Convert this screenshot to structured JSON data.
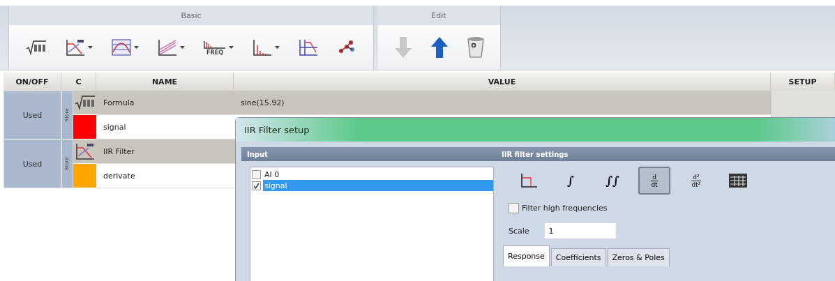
{
  "ribbon": {
    "groups": [
      {
        "label": "Basic",
        "buttons": [
          {
            "kind": "formula",
            "dropdown": false,
            "disabled": false
          },
          {
            "kind": "iir",
            "dropdown": true,
            "disabled": false
          },
          {
            "kind": "average",
            "dropdown": true,
            "disabled": false
          },
          {
            "kind": "regression",
            "dropdown": true,
            "disabled": false
          },
          {
            "kind": "freq",
            "text": "FREQ",
            "dropdown": true,
            "disabled": false
          },
          {
            "kind": "spectrum",
            "dropdown": true,
            "disabled": false
          },
          {
            "kind": "bode",
            "dropdown": false,
            "disabled": false
          },
          {
            "kind": "scatter",
            "dropdown": false,
            "disabled": false
          }
        ]
      },
      {
        "label": "Edit",
        "buttons": [
          {
            "kind": "down",
            "dropdown": false,
            "disabled": true
          },
          {
            "kind": "up",
            "dropdown": false,
            "disabled": false
          },
          {
            "kind": "delete",
            "dropdown": false,
            "disabled": false
          }
        ]
      }
    ]
  },
  "table": {
    "columns": [
      "ON/OFF",
      "C",
      "NAME",
      "VALUE",
      "SETUP"
    ],
    "groups": [
      {
        "status": "Used",
        "store": "Store",
        "rows": [
          {
            "kind": "formula",
            "name": "Formula",
            "value": "sine(15.92)"
          },
          {
            "kind": "channel",
            "color": "#ff0000",
            "name": "signal"
          }
        ]
      },
      {
        "status": "Used",
        "store": "Store",
        "rows": [
          {
            "kind": "iir",
            "name": "IIR Filter"
          },
          {
            "kind": "channel",
            "color": "#ffa500",
            "name": "derivate"
          }
        ]
      }
    ]
  },
  "dialog": {
    "title": "IIR Filter setup",
    "input": {
      "title": "Input",
      "items": [
        {
          "label": "AI 0",
          "checked": false,
          "selected": false
        },
        {
          "label": "signal",
          "checked": true,
          "selected": true
        }
      ]
    },
    "settings": {
      "title": "IIR filter settings",
      "modes": [
        {
          "kind": "lowpass",
          "selected": false
        },
        {
          "kind": "symbol",
          "text": "∫",
          "selected": false
        },
        {
          "kind": "symbol",
          "text": "∫∫",
          "selected": false
        },
        {
          "kind": "fraction",
          "numerator": "d",
          "denominator": "dt",
          "selected": true
        },
        {
          "kind": "fraction",
          "numerator": "d²",
          "denominator": "dt²",
          "selected": false
        },
        {
          "kind": "table",
          "selected": false
        }
      ],
      "high_freq": {
        "label": "Filter high frequencies",
        "checked": false
      },
      "scale": {
        "label": "Scale",
        "value": "1"
      },
      "tabs": [
        {
          "label": "Response",
          "selected": true
        },
        {
          "label": "Coefficients",
          "selected": false
        },
        {
          "label": "Zeros & Poles",
          "selected": false
        }
      ]
    }
  }
}
